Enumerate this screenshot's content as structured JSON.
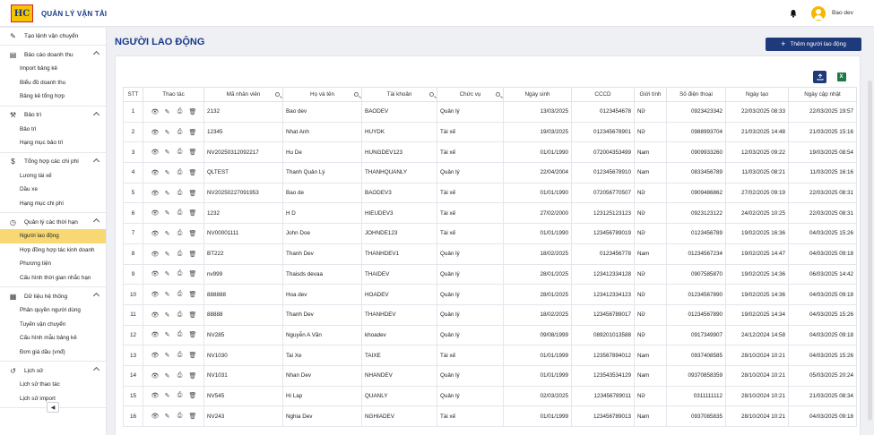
{
  "header": {
    "app_title": "QUẢN LÝ VẬN TẢI",
    "logo_text": "HC",
    "user_name": "Bao dev"
  },
  "sidebar": {
    "groups": [
      {
        "label": "Tạo lệnh vận chuyển",
        "icon": "edit-square-icon",
        "items": []
      },
      {
        "label": "Báo cáo doanh thu",
        "icon": "report-icon",
        "items": [
          "Import bảng kê",
          "Biểu đồ doanh thu",
          "Bảng kê tổng hợp"
        ]
      },
      {
        "label": "Bảo trì",
        "icon": "wrench-icon",
        "items": [
          "Bảo trì",
          "Hạng mục bảo trì"
        ]
      },
      {
        "label": "Tổng hợp các chi phí",
        "icon": "dollar-icon",
        "items": [
          "Lương tài xế",
          "Dầu xe",
          "Hạng mục chi phí"
        ]
      },
      {
        "label": "Quản lý các thời hạn",
        "icon": "clock-icon",
        "items": [
          "Người lao động",
          "Hợp đồng hợp tác kinh doanh",
          "Phương tiện",
          "Cấu hình thời gian nhắc hạn"
        ]
      },
      {
        "label": "Dữ liệu hệ thống",
        "icon": "database-icon",
        "items": [
          "Phân quyền người dùng",
          "Tuyến vận chuyển",
          "Cấu hình mẫu bảng kê",
          "Đơn giá dầu (vnđ)"
        ]
      },
      {
        "label": "Lịch sử",
        "icon": "history-icon",
        "items": [
          "Lịch sử thao tác",
          "Lịch sử import"
        ]
      }
    ],
    "active_item": "Người lao động"
  },
  "main": {
    "page_title": "NGƯỜI LAO ĐỘNG",
    "add_button": "Thêm người lao động",
    "excel_icon_text": "X"
  },
  "table": {
    "columns": [
      "STT",
      "Thao tác",
      "Mã nhân viên",
      "Họ và tên",
      "Tài khoản",
      "Chức vụ",
      "Ngày sinh",
      "CCCD",
      "Giới tính",
      "Số điện thoại",
      "Ngày tạo",
      "Ngày cập nhật"
    ],
    "rows": [
      [
        "1",
        "2132",
        "Bao dev",
        "BAODEV",
        "Quản lý",
        "13/03/2025",
        "0123454678",
        "Nữ",
        "0923423342",
        "22/03/2025 08:33",
        "22/03/2025 19:57"
      ],
      [
        "2",
        "12345",
        "Nhat Anh",
        "HUYDK",
        "Tài xế",
        "19/03/2025",
        "012345678901",
        "Nữ",
        "0988993704",
        "21/03/2025 14:48",
        "21/03/2025 15:16"
      ],
      [
        "3",
        "NV20250312092217",
        "Hu De",
        "HUNGDEV123",
        "Tài xế",
        "01/01/1990",
        "072004353499",
        "Nam",
        "0909933260",
        "12/03/2025 09:22",
        "19/03/2025 08:54"
      ],
      [
        "4",
        "QLTEST",
        "Thanh Quản Lý",
        "THANHQUANLY",
        "Quản lý",
        "22/04/2004",
        "012345678910",
        "Nam",
        "0833456789",
        "11/03/2025 08:21",
        "11/03/2025 16:16"
      ],
      [
        "5",
        "NV20250227091953",
        "Bao de",
        "BAODEV3",
        "Tài xế",
        "01/01/1990",
        "072056770507",
        "Nữ",
        "0909486862",
        "27/02/2025 09:19",
        "22/03/2025 08:31"
      ],
      [
        "6",
        "1232",
        "H D",
        "HIEUDEV3",
        "Tài xế",
        "27/02/2000",
        "123125123123",
        "Nữ",
        "0923123122",
        "24/02/2025 10:25",
        "22/03/2025 08:31"
      ],
      [
        "7",
        "NV00001111",
        "John Doe",
        "JOHNDE123",
        "Tài xế",
        "01/01/1990",
        "123456789019",
        "Nữ",
        "0123456789",
        "19/02/2025 16:36",
        "04/03/2025 15:26"
      ],
      [
        "8",
        "BT222",
        "Thanh Dev",
        "THANHDEV1",
        "Quản lý",
        "18/02/2025",
        "0123456778",
        "Nam",
        "01234567234",
        "19/02/2025 14:47",
        "04/03/2025 09:18"
      ],
      [
        "9",
        "nv999",
        "Thaisds devaa",
        "THAIDEV",
        "Quản lý",
        "28/01/2025",
        "123412334128",
        "Nữ",
        "0907585870",
        "19/02/2025 14:36",
        "06/03/2025 14:42"
      ],
      [
        "10",
        "888888",
        "Hoa dev",
        "HOADEV",
        "Quản lý",
        "28/01/2025",
        "123412334123",
        "Nữ",
        "01234567890",
        "19/02/2025 14:36",
        "04/03/2025 09:18"
      ],
      [
        "11",
        "88888",
        "Thanh Dev",
        "THANHDEV",
        "Quản lý",
        "18/02/2025",
        "123456789017",
        "Nữ",
        "01234567890",
        "19/02/2025 14:34",
        "04/03/2025 15:26"
      ],
      [
        "12",
        "NV285",
        "Nguyễn A Văn",
        "khoadev",
        "Quản lý",
        "09/08/1999",
        "089201013588",
        "Nữ",
        "0917349907",
        "24/12/2024 14:58",
        "04/03/2025 09:18"
      ],
      [
        "13",
        "NV1030",
        "Tai Xe",
        "TAIXE",
        "Tài xế",
        "01/01/1999",
        "123567894012",
        "Nam",
        "0937408585",
        "28/10/2024 10:21",
        "04/03/2025 15:26"
      ],
      [
        "14",
        "NV1031",
        "Nhan Dev",
        "NHANDEV",
        "Quản lý",
        "01/01/1999",
        "123543534129",
        "Nam",
        "09370858359",
        "28/10/2024 10:21",
        "05/03/2025 20:24"
      ],
      [
        "15",
        "NV545",
        "Hi Lap",
        "QUANLY",
        "Quản lý",
        "02/03/2025",
        "123456789011",
        "Nữ",
        "0311111112",
        "28/10/2024 10:21",
        "21/03/2025 08:34"
      ],
      [
        "16",
        "NV243",
        "Nghia Dev",
        "NGHIADEV",
        "Tài xế",
        "01/01/1999",
        "123456789013",
        "Nam",
        "0937085835",
        "28/10/2024 10:21",
        "04/03/2025 09:18"
      ]
    ]
  },
  "colors": {
    "brand": "#1f3a7a",
    "active": "#f7d873",
    "logo": "#f4c400"
  }
}
